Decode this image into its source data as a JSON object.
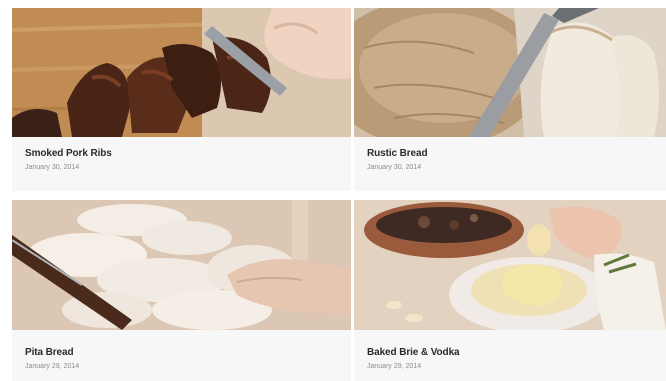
{
  "recipes": [
    {
      "title": "Smoked Pork Ribs",
      "date": "January 30, 2014",
      "image": "smoked-pork-ribs-photo"
    },
    {
      "title": "Rustic Bread",
      "date": "January 30, 2014",
      "image": "rustic-bread-photo"
    },
    {
      "title": "Pita Bread",
      "date": "January 29, 2014",
      "image": "pita-bread-photo"
    },
    {
      "title": "Baked Brie & Vodka",
      "date": "January 29, 2014",
      "image": "baked-brie-photo"
    }
  ],
  "colors": {
    "wood": "#c89862",
    "background": "#ffffff",
    "meta_bg": "#f7f7f7",
    "title": "#2b2b2b",
    "date": "#8b8b8b"
  }
}
